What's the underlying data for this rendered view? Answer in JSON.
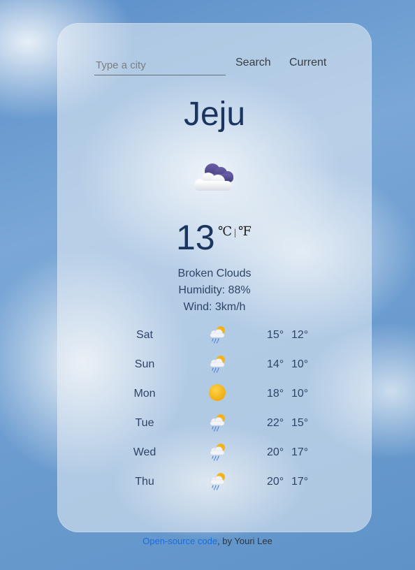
{
  "search": {
    "placeholder": "Type a city",
    "value": "",
    "search_label": "Search",
    "current_label": "Current"
  },
  "city": "Jeju",
  "current": {
    "icon": "night-cloud-icon",
    "temperature": "13",
    "unit_celsius": "℃",
    "unit_separator": "|",
    "unit_fahrenheit": "℉",
    "description": "Broken Clouds",
    "humidity": "Humidity: 88%",
    "wind": "Wind: 3km/h"
  },
  "forecast": [
    {
      "day": "Sat",
      "icon": "sun-rain-cloud-icon",
      "max": "15°",
      "min": "12°"
    },
    {
      "day": "Sun",
      "icon": "sun-rain-cloud-icon",
      "max": "14°",
      "min": "10°"
    },
    {
      "day": "Mon",
      "icon": "sun-icon",
      "max": "18°",
      "min": "10°"
    },
    {
      "day": "Tue",
      "icon": "sun-rain-cloud-icon",
      "max": "22°",
      "min": "15°"
    },
    {
      "day": "Wed",
      "icon": "sun-rain-cloud-icon",
      "max": "20°",
      "min": "17°"
    },
    {
      "day": "Thu",
      "icon": "sun-rain-cloud-icon",
      "max": "20°",
      "min": "17°"
    }
  ],
  "footer": {
    "link_text": "Open-source code",
    "suffix": ", by Youri Lee"
  },
  "colors": {
    "accent_text": "#1c3560",
    "link": "#1a6ddf",
    "sun": "#f5b315"
  }
}
